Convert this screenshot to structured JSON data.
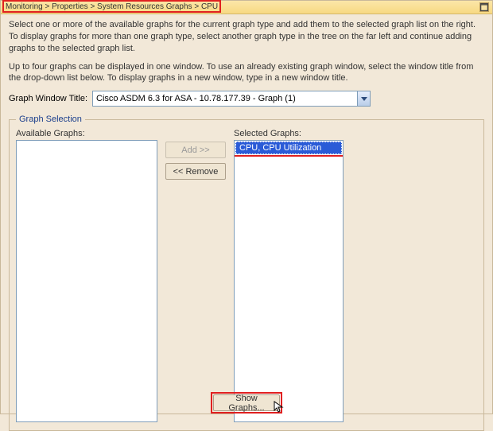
{
  "header": {
    "breadcrumb": "Monitoring > Properties > System Resources Graphs > CPU"
  },
  "text": {
    "instr1": "Select one or more of the available graphs for the current graph type and add them to the selected graph list on the right. To display graphs for more than one graph type, select another graph type in the tree on the far left and continue adding graphs to the selected graph list.",
    "instr2": "Up to four graphs can be displayed in one window. To use an already existing graph window, select the window title from the drop-down list below. To display graphs in a new window, type in a new window title.",
    "window_title_label": "Graph Window Title:",
    "fieldset_legend": "Graph Selection",
    "available_label": "Available Graphs:",
    "selected_label": "Selected Graphs:"
  },
  "combo": {
    "value": "Cisco ASDM 6.3 for ASA - 10.78.177.39 - Graph (1)"
  },
  "buttons": {
    "add": "Add >>",
    "remove": "<< Remove",
    "show": "Show Graphs..."
  },
  "available_items": [],
  "selected_items": [
    "CPU, CPU Utilization"
  ]
}
